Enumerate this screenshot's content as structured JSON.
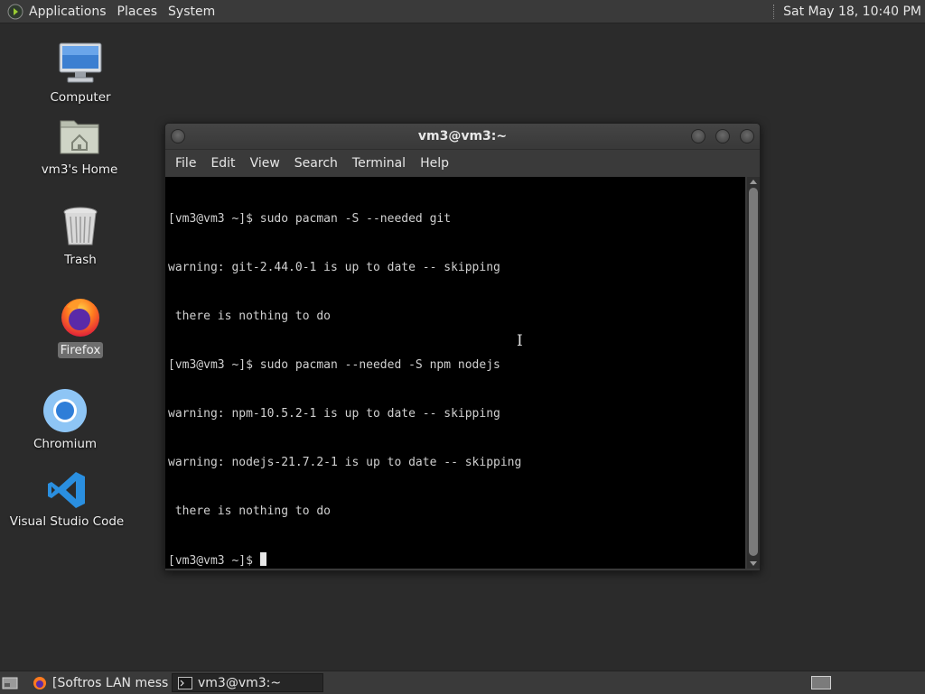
{
  "top_panel": {
    "menus": [
      "Applications",
      "Places",
      "System"
    ],
    "clock": "Sat May 18, 10:40 PM"
  },
  "desktop": {
    "icons": [
      {
        "label": "Computer",
        "icon": "computer-icon"
      },
      {
        "label": "vm3's Home",
        "icon": "home-folder-icon"
      },
      {
        "label": "Trash",
        "icon": "trash-icon"
      },
      {
        "label": "Firefox",
        "icon": "firefox-icon"
      },
      {
        "label": "Chromium",
        "icon": "chromium-icon"
      },
      {
        "label": "Visual Studio Code",
        "icon": "vscode-icon"
      }
    ]
  },
  "terminal": {
    "title": "vm3@vm3:~",
    "menu": [
      "File",
      "Edit",
      "View",
      "Search",
      "Terminal",
      "Help"
    ],
    "lines": [
      "[vm3@vm3 ~]$ sudo pacman -S --needed git",
      "warning: git-2.44.0-1 is up to date -- skipping",
      " there is nothing to do",
      "[vm3@vm3 ~]$ sudo pacman --needed -S npm nodejs",
      "warning: npm-10.5.2-1 is up to date -- skipping",
      "warning: nodejs-21.7.2-1 is up to date -- skipping",
      " there is nothing to do"
    ],
    "prompt": "[vm3@vm3 ~]$ "
  },
  "taskbar": {
    "tasks": [
      {
        "label": "[Softros LAN messe...",
        "icon": "firefox-icon"
      },
      {
        "label": "vm3@vm3:~",
        "icon": "terminal-icon"
      }
    ]
  }
}
